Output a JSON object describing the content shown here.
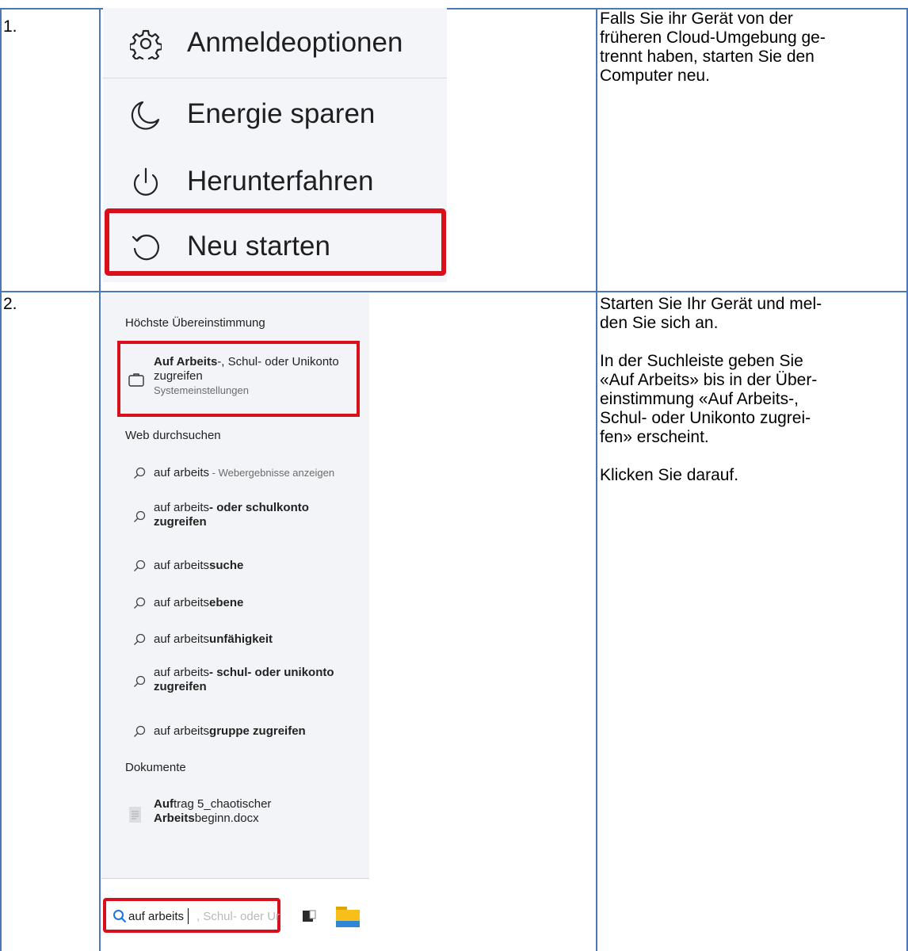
{
  "steps": [
    {
      "number": "1.",
      "instruction": [
        "Falls Sie ihr Gerät von der",
        "früheren Cloud-Umgebung ge-",
        "trennt haben, starten Sie den",
        "Computer neu."
      ]
    },
    {
      "number": "2.",
      "instruction_p1": [
        "Starten Sie Ihr Gerät und mel-",
        "den Sie sich an."
      ],
      "instruction_p2": [
        "In der Suchleiste geben Sie",
        "«Auf Arbeits» bis in der Über-",
        "einstimmung «Auf Arbeits-,",
        "Schul- oder Unikonto zugrei-",
        "fen» erscheint."
      ],
      "instruction_p3": [
        "Klicken Sie darauf."
      ]
    }
  ],
  "power_menu": {
    "items": [
      {
        "label": "Anmeldeoptionen",
        "icon": "gear-icon"
      },
      {
        "label": "Energie sparen",
        "icon": "moon-icon"
      },
      {
        "label": "Herunterfahren",
        "icon": "power-icon"
      },
      {
        "label": "Neu starten",
        "icon": "restart-icon",
        "highlighted": true
      }
    ],
    "highlight_color": "#d7101b"
  },
  "search_panel": {
    "best_match_heading": "Höchste Übereinstimmung",
    "best_match": {
      "title_bold": "Auf Arbeits",
      "title_rest": "-, Schul- oder Unikonto",
      "title_line2": "zugreifen",
      "subtitle": "Systemeinstellungen",
      "icon": "briefcase-icon"
    },
    "web_heading": "Web durchsuchen",
    "web_results": [
      {
        "normal": "auf arbeits",
        "bold": "",
        "suffix": " - Webergebnisse anzeigen",
        "line2": ""
      },
      {
        "normal": "auf arbeits",
        "bold": "- oder schulkonto",
        "suffix": "",
        "line2": "zugreifen"
      },
      {
        "normal": "auf arbeits",
        "bold": "suche",
        "suffix": "",
        "line2": ""
      },
      {
        "normal": "auf arbeits",
        "bold": "ebene",
        "suffix": "",
        "line2": ""
      },
      {
        "normal": "auf arbeits",
        "bold": "unfähigkeit",
        "suffix": "",
        "line2": ""
      },
      {
        "normal": "auf arbeits",
        "bold": "- schul- oder unikonto",
        "suffix": "",
        "line2": "zugreifen"
      },
      {
        "normal": "auf arbeits",
        "bold": "gruppe zugreifen",
        "suffix": "",
        "line2": ""
      }
    ],
    "documents_heading": "Dokumente",
    "document": {
      "line1_bold": "Auf",
      "line1_rest": "trag 5_chaotischer",
      "line2_bold": "Arbeits",
      "line2_rest": "beginn.docx",
      "icon": "document-icon"
    }
  },
  "taskbar": {
    "search_text": "auf arbeits",
    "search_ghost": ", Schul- oder Ur",
    "icons": [
      "search-icon",
      "taskview-icon",
      "file-explorer-icon"
    ]
  }
}
